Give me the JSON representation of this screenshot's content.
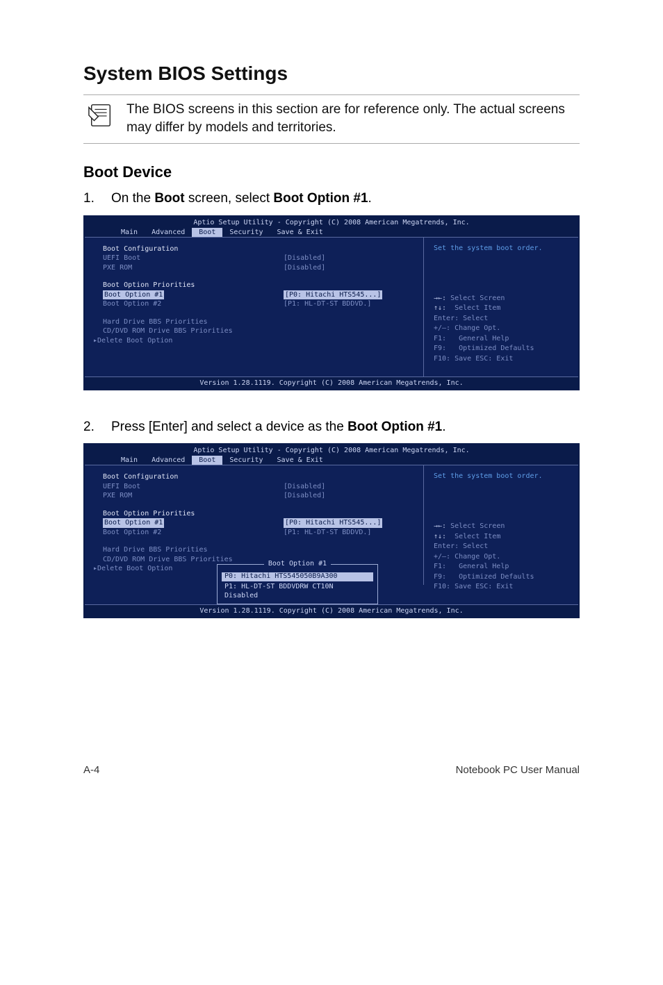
{
  "page": {
    "title": "System BIOS Settings",
    "note": "The BIOS screens in this section are for reference only. The actual screens may differ by models and territories.",
    "subtitle": "Boot Device",
    "step1_num": "1.",
    "step1_pre": "On the ",
    "step1_b1": "Boot",
    "step1_mid": " screen, select ",
    "step1_b2": "Boot Option #1",
    "step1_post": ".",
    "step2_num": "2.",
    "step2_pre": "Press [Enter] and select a device as the ",
    "step2_b1": "Boot Option #1",
    "step2_post": "."
  },
  "bios": {
    "header": "Aptio Setup Utility - Copyright (C) 2008 American Megatrends, Inc.",
    "tabs": {
      "main": "Main",
      "advanced": "Advanced",
      "boot": "Boot",
      "security": "Security",
      "save": "Save & Exit"
    },
    "config": {
      "title": "Boot Configuration",
      "uefi_label": "UEFI Boot",
      "uefi_val": "[Disabled]",
      "pxe_label": "PXE ROM",
      "pxe_val": "[Disabled]"
    },
    "priorities": {
      "title": "Boot Option Priorities",
      "opt1_label": "Boot Option #1",
      "opt1_val": "[P0: Hitachi HTS545...]",
      "opt2_label": "Boot Option #2",
      "opt2_val": "[P1: HL-DT-ST BDDVD.]"
    },
    "extra": {
      "hdd": "Hard Drive BBS Priorities",
      "cd": "CD/DVD ROM Drive BBS Priorities",
      "del": "Delete Boot Option",
      "tri": "▸"
    },
    "help": {
      "top": "Set the system boot order.",
      "k1a": "→←:",
      "k1b": "Select Screen",
      "k2a": "↑↓:",
      "k2b": "Select Item",
      "k3": "Enter: Select",
      "k4": "+/—: Change Opt.",
      "k5a": "F1:",
      "k5b": "General Help",
      "k6a": "F9:",
      "k6b": "Optimized Defaults",
      "k7": "F10: Save   ESC: Exit"
    },
    "footer": "Version 1.28.1119. Copyright (C) 2008 American Megatrends, Inc."
  },
  "popup": {
    "title": "Boot Option #1",
    "item1": "P0: Hitachi HTS545050B9A300",
    "item2": "P1: HL-DT-ST BDDVDRW CT10N",
    "item3": "Disabled"
  },
  "footer": {
    "left": "A-4",
    "right": "Notebook PC User Manual"
  }
}
